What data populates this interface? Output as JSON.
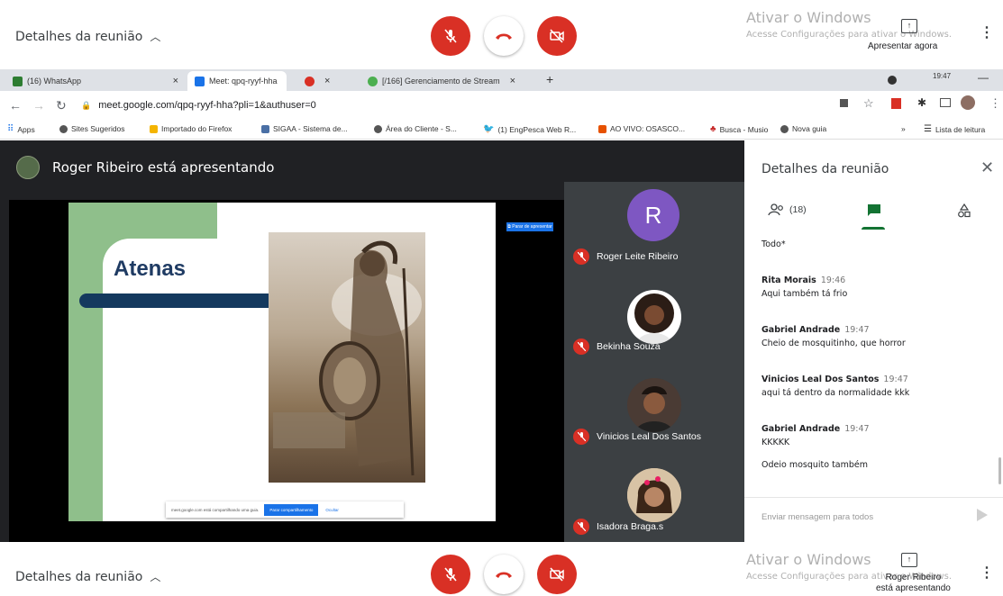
{
  "top_bar": {
    "details_label": "Detalhes da reunião",
    "win_activation_title": "Ativar o Windows",
    "win_activation_sub": "Acesse Configurações para ativar o Windows.",
    "present_label": "Apresentar agora"
  },
  "bottom_bar": {
    "details_label": "Detalhes da reunião",
    "win_activation_title": "Ativar o Windows",
    "win_activation_sub": "Acesse Configurações para ativar o Windows.",
    "presenting_label_1": "Roger Ribeiro",
    "presenting_label_2": "está apresentando"
  },
  "browser": {
    "tabs": [
      {
        "label": "(16) WhatsApp",
        "icon": "whatsapp-icon"
      },
      {
        "label": "Meet: qpq-ryyf-hha",
        "icon": "meet-icon"
      },
      {
        "label": "[/166] Gerenciamento de Stream",
        "icon": "stream-icon"
      }
    ],
    "new_tab": "+",
    "clock": "19:47",
    "url": "meet.google.com/qpq-ryyf-hha?pli=1&authuser=0",
    "bookmarks": [
      {
        "label": "Apps"
      },
      {
        "label": "Sites Sugeridos"
      },
      {
        "label": "Importado do Firefox"
      },
      {
        "label": "SIGAA - Sistema de..."
      },
      {
        "label": "Área do Cliente - S..."
      },
      {
        "label": "(1) EngPesca Web R..."
      },
      {
        "label": "AO VIVO: OSASCO..."
      },
      {
        "label": "Busca - Musio"
      },
      {
        "label": "Nova guia"
      }
    ],
    "bookmarks_more": "»",
    "reading_list": "Lista de leitura"
  },
  "stage": {
    "presenter_heading": "Roger Ribeiro está apresentando",
    "slide_title": "Atenas",
    "stop_presenting_small": "⧉ Parar de apresentar",
    "share_bar_text": "meet.google.com está compartilhando uma guia.",
    "share_bar_stop": "Parar compartilhamento",
    "share_bar_hide": "Ocultar",
    "participants": [
      {
        "name": "Roger Leite Ribeiro",
        "initial": "R",
        "avatar_color": "#7e57c2"
      },
      {
        "name": "Bekinha Souza"
      },
      {
        "name": "Vinicios Leal Dos Santos"
      },
      {
        "name": "Isadora Braga.s"
      }
    ]
  },
  "panel": {
    "title": "Detalhes da reunião",
    "people_count": "(18)",
    "chat_prefix_line": "Todo*",
    "messages": [
      {
        "sender": "Rita Morais",
        "time": "19:46",
        "text": "Aqui também tá frio"
      },
      {
        "sender": "Gabriel Andrade",
        "time": "19:47",
        "text": "Cheio de mosquitinho, que horror"
      },
      {
        "sender": "Vinicios Leal Dos Santos",
        "time": "19:47",
        "text": "aqui tá dentro da normalidade kkk"
      },
      {
        "sender": "Gabriel Andrade",
        "time": "19:47",
        "text": "KKKKK",
        "extra": "Odeio mosquito também"
      }
    ],
    "input_placeholder": "Enviar mensagem para todos"
  },
  "colors": {
    "red_control": "#d93025",
    "meet_green": "#137333",
    "stage_bg": "#202124",
    "tile_bg": "#3c4043"
  }
}
